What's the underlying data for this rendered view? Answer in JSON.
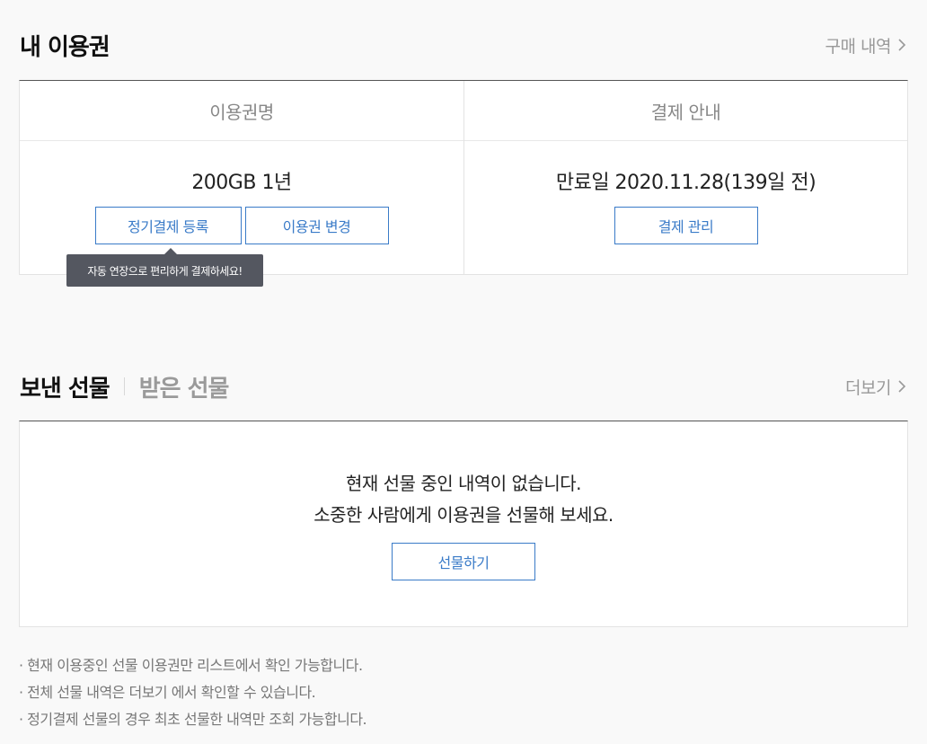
{
  "my_tickets": {
    "title": "내 이용권",
    "purchase_history_label": "구매 내역",
    "table": {
      "header_name": "이용권명",
      "header_payment": "결제 안내",
      "ticket_name": "200GB 1년",
      "expiry_text": "만료일 2020.11.28(139일 전)",
      "register_recurring_label": "정기결제 등록",
      "change_ticket_label": "이용권 변경",
      "manage_payment_label": "결제 관리"
    },
    "tooltip": "자동 연장으로 편리하게 결제하세요!"
  },
  "gifts": {
    "tab_sent": "보낸 선물",
    "tab_received": "받은 선물",
    "more_label": "더보기",
    "empty_line1": "현재 선물 중인 내역이 없습니다.",
    "empty_line2": "소중한 사람에게 이용권을 선물해 보세요.",
    "gift_button_label": "선물하기"
  },
  "notes": [
    "· 현재 이용중인 선물 이용권만 리스트에서 확인 가능합니다.",
    "· 전체 선물 내역은 더보기 에서 확인할 수 있습니다.",
    "· 정기결제 선물의 경우 최초 선물한 내역만 조회 가능합니다."
  ],
  "colors": {
    "accent": "#3a7bc8",
    "tooltip_bg": "#545760",
    "muted_text": "#999999"
  },
  "icons": {
    "chevron": "chevron-right-icon"
  }
}
